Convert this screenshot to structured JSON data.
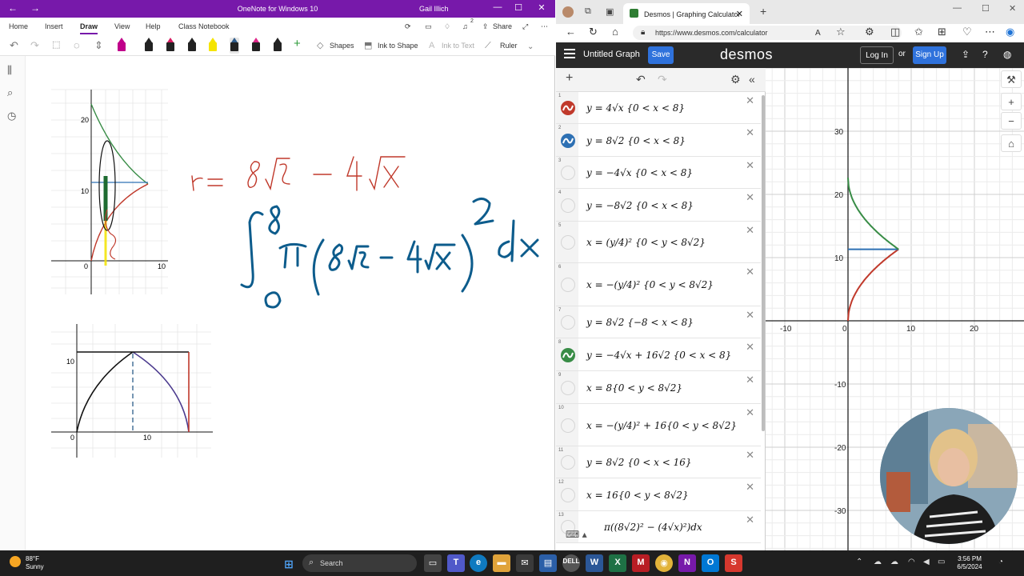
{
  "onenote": {
    "window_title": "OneNote for Windows 10",
    "user": "Gail Illich",
    "menus": [
      "Home",
      "Insert",
      "Draw",
      "View",
      "Help",
      "Class Notebook"
    ],
    "active_menu": "Draw",
    "share_label": "Share",
    "notification_badge": "2",
    "toolbar": {
      "shapes_label": "Shapes",
      "ink_to_shape_label": "Ink to Shape",
      "ink_to_text_label": "Ink to Text",
      "ruler_label": "Ruler"
    },
    "pen_colors": [
      "#111111",
      "#d81b60",
      "#222222",
      "#f5e400",
      "#2f5c8a",
      "#e0288a",
      "#111111"
    ],
    "sketch1": {
      "y_ticks": [
        "20",
        "10"
      ],
      "x_ticks": [
        "0",
        "10"
      ]
    },
    "sketch2": {
      "y_ticks": [
        "10"
      ],
      "x_ticks": [
        "0",
        "10"
      ]
    }
  },
  "browser": {
    "tab_title": "Desmos | Graphing Calculator",
    "url": "https://www.desmos.com/calculator"
  },
  "desmos": {
    "graph_title": "Untitled Graph",
    "save_label": "Save",
    "logo": "desmos",
    "login_label": "Log In",
    "or_label": "or",
    "signup_label": "Sign Up",
    "expressions": [
      {
        "num": "1",
        "text": "y = 4√x {0 < x < 8}",
        "color": "#c0392b",
        "active": true
      },
      {
        "num": "2",
        "text": "y = 8√2 {0 < x < 8}",
        "color": "#2d70b3",
        "active": true
      },
      {
        "num": "3",
        "text": "y = −4√x {0 < x < 8}",
        "color": "",
        "active": false
      },
      {
        "num": "4",
        "text": "y = −8√2 {0 < x < 8}",
        "color": "",
        "active": false
      },
      {
        "num": "5",
        "text": "x = (y/4)² {0 < y < 8√2}",
        "color": "",
        "active": false
      },
      {
        "num": "6",
        "text": "x = −(y/4)² {0 < y < 8√2}",
        "color": "",
        "active": false
      },
      {
        "num": "7",
        "text": "y = 8√2 {−8 < x < 8}",
        "color": "",
        "active": false
      },
      {
        "num": "8",
        "text": "y = −4√x + 16√2 {0 < x < 8}",
        "color": "#388c46",
        "active": true
      },
      {
        "num": "9",
        "text": "x = 8{0 < y < 8√2}",
        "color": "",
        "active": false
      },
      {
        "num": "10",
        "text": "x = −(y/4)² + 16{0 < y < 8√2}",
        "color": "",
        "active": false
      },
      {
        "num": "11",
        "text": "y = 8√2 {0 < x < 16}",
        "color": "",
        "active": false
      },
      {
        "num": "12",
        "text": "x = 16{0 < y < 8√2}",
        "color": "",
        "active": false
      },
      {
        "num": "13",
        "text": "π((8√2)² − (4√x)²)dx",
        "color": "",
        "active": false
      }
    ],
    "graph": {
      "x_ticks": [
        "-10",
        "0",
        "10",
        "20"
      ],
      "y_ticks": [
        "30",
        "20",
        "10",
        "-10",
        "-20",
        "-30"
      ],
      "curve_colors": {
        "red": "#c0392b",
        "blue": "#2d70b3",
        "green": "#388c46"
      }
    }
  },
  "taskbar": {
    "weather_temp": "88°F",
    "weather_desc": "Sunny",
    "search_placeholder": "Search",
    "time": "3:56 PM",
    "date": "6/5/2024"
  }
}
